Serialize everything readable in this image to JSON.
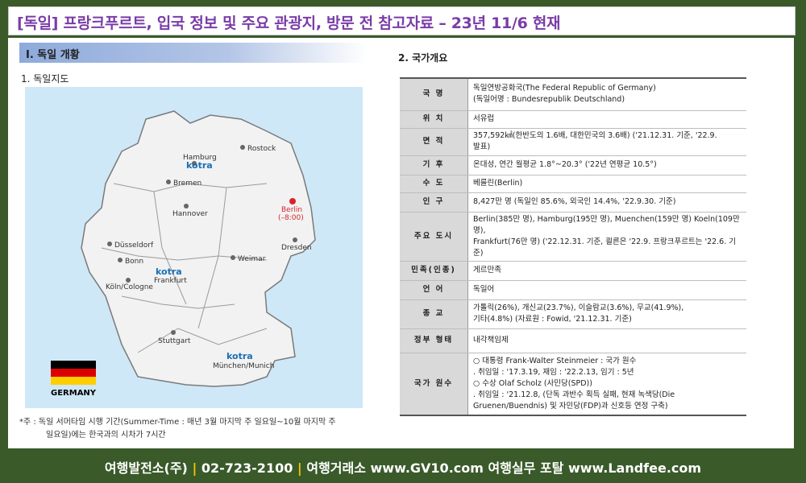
{
  "header": {
    "title": "[독일] 프랑크푸르트, 입국 정보 및 주요 관광지, 방문 전 참고자료 – 23년 11/6 현재"
  },
  "left": {
    "section_title": "I. 독일 개황",
    "subtitle": "1. 독일지도",
    "map": {
      "cities": [
        {
          "name": "Rostock"
        },
        {
          "name": "Hamburg"
        },
        {
          "name": "Bremen"
        },
        {
          "name": "Berlin"
        },
        {
          "name": "(–8:00)"
        },
        {
          "name": "Hannover"
        },
        {
          "name": "Düsseldorf"
        },
        {
          "name": "Dresden"
        },
        {
          "name": "Bonn"
        },
        {
          "name": "Weimar"
        },
        {
          "name": "Frankfurt"
        },
        {
          "name": "Köln/Cologne"
        },
        {
          "name": "Stuttgart"
        },
        {
          "name": "München/Munich"
        }
      ],
      "kotra": [
        "kotra",
        "kotra",
        "kotra"
      ],
      "country_label": "GERMANY",
      "colors": {
        "sea": "#cfe8f7",
        "land": "#f2f2f2",
        "border": "#7a7a7a",
        "kotra": "#1a6fb5",
        "berlin": "#d7262b"
      }
    },
    "footnote": {
      "line1": "*주 : 독일 서머타임 시행 기간(Summer-Time : 매년 3월 마지막 주 일요일~10월 마지막 주",
      "line2": "일요일)에는 한국과의 시차가 7시간"
    }
  },
  "right": {
    "subtitle": "2. 국가개요",
    "rows": [
      {
        "key": "국 명",
        "lines": [
          "독일연방공화국(The Federal Republic of Germany)",
          "(독일어명 : Bundesrepublik Deutschland)"
        ]
      },
      {
        "key": "위 치",
        "lines": [
          "서유럽"
        ]
      },
      {
        "key": "면 적",
        "lines": [
          "357,592㎢(한반도의 1.6배, 대한민국의 3.6배) ('21.12.31. 기준, '22.9.",
          "발표)"
        ]
      },
      {
        "key": "기 후",
        "lines": [
          "온대성, 연간 월평균 1.8°~20.3° ('22년 연평균 10.5°)"
        ]
      },
      {
        "key": "수 도",
        "lines": [
          "베를린(Berlin)"
        ]
      },
      {
        "key": "인 구",
        "lines": [
          "8,427만 명 (독일인 85.6%, 외국인 14.4%, '22.9.30. 기준)"
        ]
      },
      {
        "key": "주요 도시",
        "lines": [
          "Berlin(385만 명), Hamburg(195만 명), Muenchen(159만 명) Koeln(109만 명),",
          "Frankfurt(76만 명) ('22.12.31. 기준, 쾰른은 '22.9. 프랑크푸르트는 '22.6. 기준)"
        ]
      },
      {
        "key": "민족(인종)",
        "lines": [
          "게르만족"
        ]
      },
      {
        "key": "언 어",
        "lines": [
          "독일어"
        ]
      },
      {
        "key": "종 교",
        "lines": [
          "가톨릭(26%), 개신교(23.7%), 이슬람교(3.6%), 무교(41.9%),",
          "기타(4.8%) (자료원 : Fowid, '21.12.31. 기준)"
        ]
      },
      {
        "key": "정부 형태",
        "lines": [
          "내각책임제"
        ]
      },
      {
        "key": "국가 원수",
        "lines": [
          "○ 대통령 Frank-Walter Steinmeier : 국가 원수",
          ". 취임일 : '17.3.19, 재임 : '22.2.13, 임기 : 5년",
          "○ 수상 Olaf Scholz (사민당(SPD))",
          ". 취임일 : '21.12.8, (단독 과반수 획득 실패, 현재 녹색당(Die",
          "Gruenen/Buendnis) 및 자민당(FDP)과 신호등 연정 구축)"
        ]
      }
    ]
  },
  "footer": {
    "part1": "여행발전소(주)",
    "sep1": "|",
    "part2": "02-723-2100",
    "sep2": "|",
    "part3": "여행거래소  www.GV10.com  여행실무 포탈  www.Landfee.com"
  }
}
